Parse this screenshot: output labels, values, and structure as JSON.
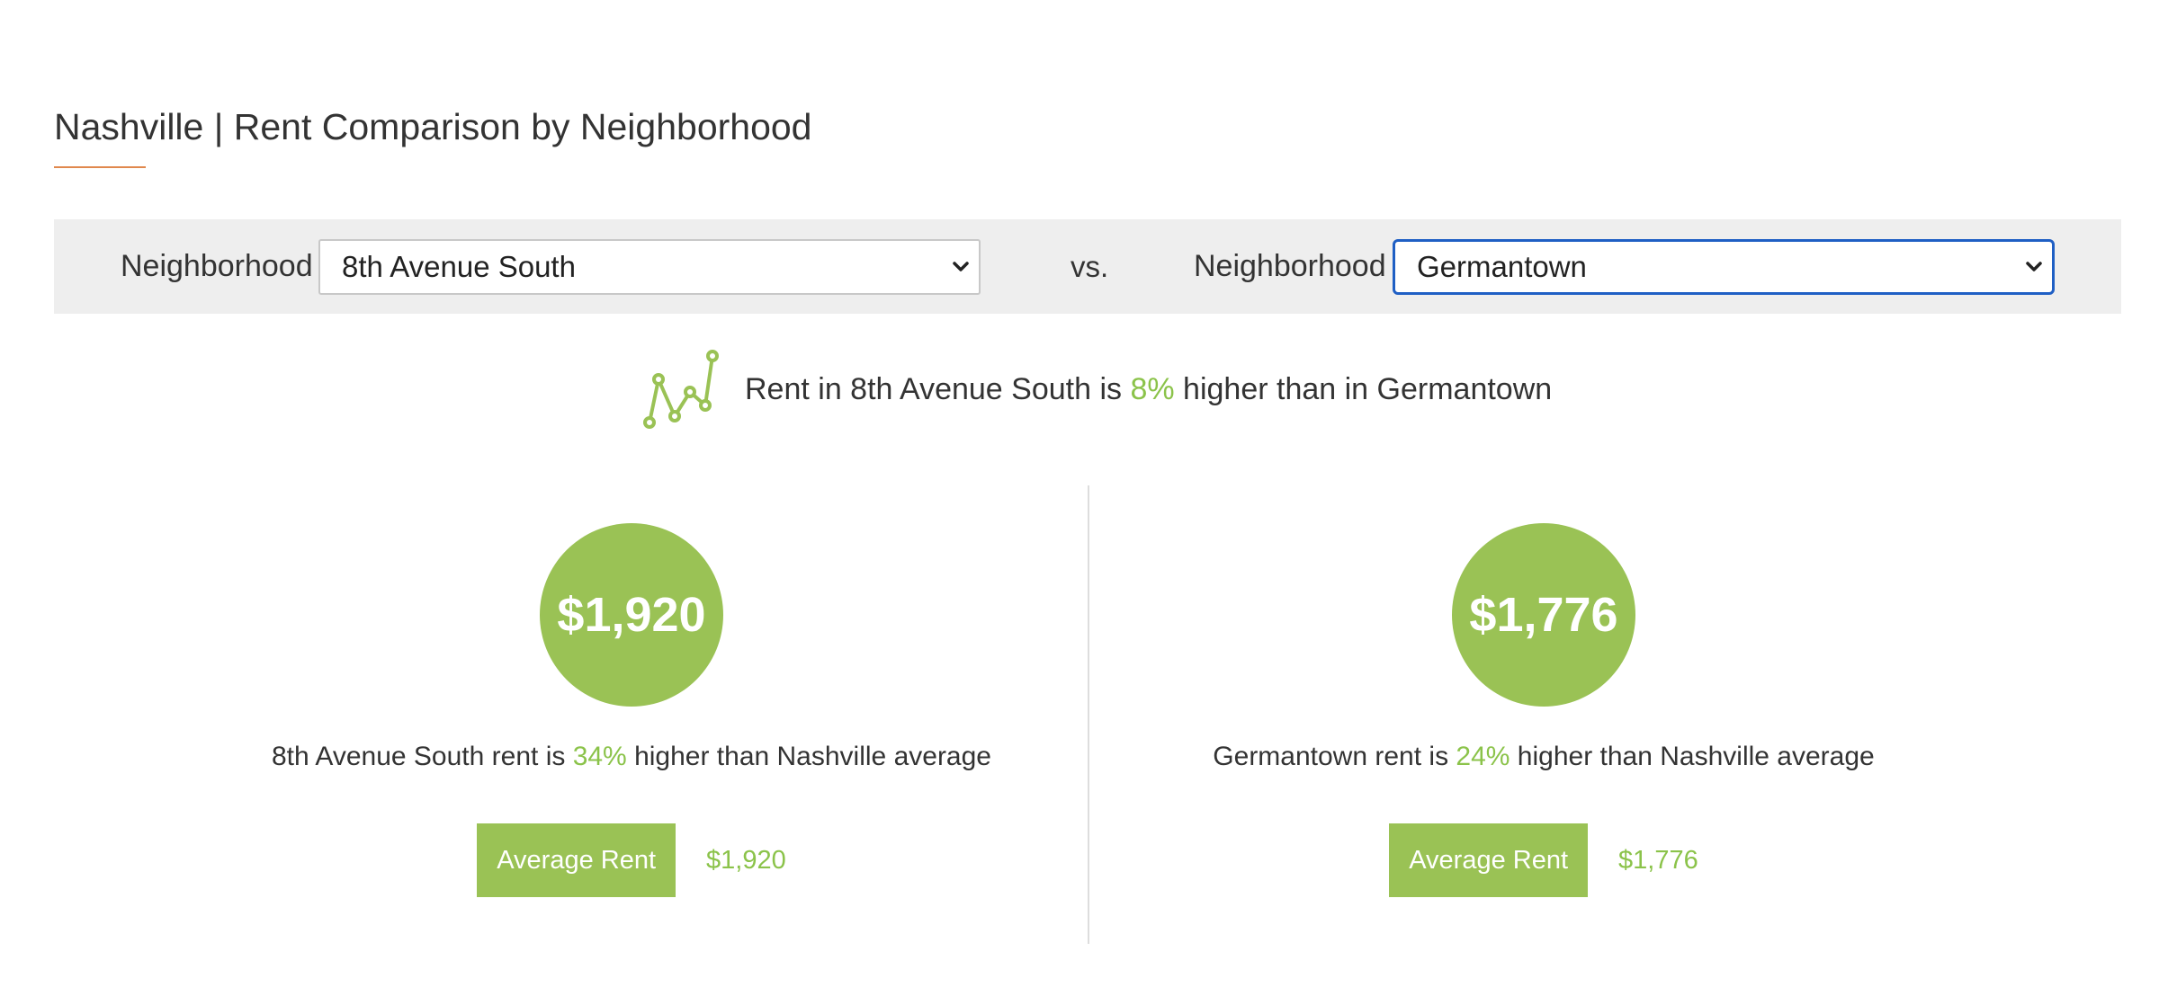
{
  "header": {
    "title": "Nashville | Rent Comparison by Neighborhood"
  },
  "filters": {
    "left_label": "Neighborhood",
    "left_selected": "8th Avenue South",
    "vs_label": "vs.",
    "right_label": "Neighborhood",
    "right_selected": "Germantown"
  },
  "summary": {
    "prefix": "Rent in 8th Avenue South is ",
    "percent": "8%",
    "suffix": " higher than in Germantown",
    "icon": "line-chart-icon"
  },
  "left": {
    "circle_value": "$1,920",
    "compare_prefix": "8th Avenue South rent is ",
    "compare_percent": "34%",
    "compare_suffix": " higher than Nashville average",
    "button_label": "Average Rent",
    "rent_value": "$1,920"
  },
  "right": {
    "circle_value": "$1,776",
    "compare_prefix": "Germantown rent is ",
    "compare_percent": "24%",
    "compare_suffix": " higher than Nashville average",
    "button_label": "Average Rent",
    "rent_value": "$1,776"
  },
  "colors": {
    "accent_green": "#9ac255",
    "accent_text_green": "#8bc34a",
    "title_underline": "#e0884d",
    "focus_border": "#1f5fc4",
    "filter_bar_bg": "#eeeeee"
  }
}
